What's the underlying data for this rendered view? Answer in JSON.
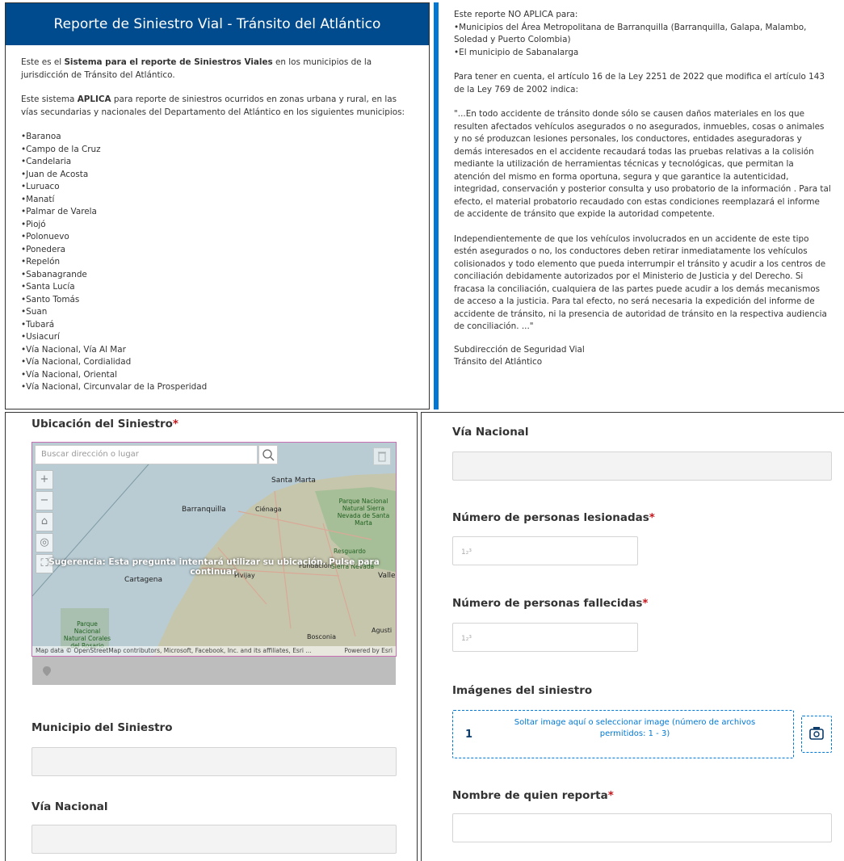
{
  "panel1": {
    "title": "Reporte de Siniestro Vial - Tránsito del Atlántico",
    "intro_before": "Este es el ",
    "intro_bold": "Sistema para el reporte de Siniestros Viales",
    "intro_after": " en los municipios de la jurisdicción de Tránsito del Atlántico.",
    "scope_before": "Este sistema ",
    "scope_bold": "APLICA",
    "scope_after": " para reporte de siniestros ocurridos en zonas urbana y rural, en las vías secundarias y nacionales del Departamento del Atlántico en los siguientes municipios:",
    "municipios": [
      "Baranoa",
      "Campo de la Cruz",
      "Candelaria",
      "Juan de Acosta",
      "Luruaco",
      "Manatí",
      "Palmar de Varela",
      "Piojó",
      "Polonuevo",
      "Ponedera",
      "Repelón",
      "Sabanagrande",
      "Santa Lucía",
      "Santo Tomás",
      "Suan",
      "Tubará",
      "Usiacurí",
      "Vía Nacional, Vía Al Mar",
      "Vía Nacional, Cordialidad",
      "Vía Nacional, Oriental",
      "Vía Nacional, Circunvalar de la Prosperidad"
    ]
  },
  "panel2": {
    "no_aplica_title": "Este reporte NO APLICA para:",
    "no_aplica_1": "•Municipios del Área Metropolitana de Barranquilla (Barranquilla, Galapa, Malambo, Soledad y Puerto Colombia)",
    "no_aplica_2": "•El municipio de Sabanalarga",
    "ley_intro": "Para tener en cuenta, el artículo 16 de la Ley 2251 de 2022 que modifica el artículo 143 de la Ley 769 de 2002 indica:",
    "quote_1": "\"...En todo accidente de tránsito donde sólo se causen daños materiales en los que resulten afectados vehículos asegurados o no asegurados, inmuebles, cosas o animales y no sé produzcan lesiones personales, los conductores, entidades aseguradoras y demás interesados en el accidente recaudará todas las pruebas relativas a la colisión mediante la utilización de herramientas técnicas y tecnológicas, que permitan la atención del mismo en forma oportuna, segura y que garantice la autenticidad, integridad, conservación y posterior consulta y uso probatorio de la información . Para tal efecto, el material probatorio recaudado con estas condiciones reemplazará el informe de accidente de tránsito que expide la autoridad competente.",
    "quote_2": "Independientemente de que los vehículos involucrados en un accidente de este tipo estén asegurados o no, los conductores deben retirar inmediatamente los vehículos colisionados y todo elemento que pueda interrumpir el tránsito y acudir a los centros de conciliación debidamente autorizados por el Ministerio de Justicia y del Derecho. Si fracasa la conciliación, cualquiera de las partes puede acudir a los demás mecanismos de acceso a la justicia. Para tal efecto, no será necesaria la expedición del informe de accidente de tránsito, ni la presencia de autoridad de tránsito en la respectiva audiencia de conciliación. ...\"",
    "sign_1": "Subdirección de Seguridad Vial",
    "sign_2": "Tránsito del Atlántico"
  },
  "panel3": {
    "ubicacion_label": "Ubicación del Siniestro",
    "required_mark": "*",
    "search_placeholder": "Buscar dirección o lugar",
    "map_hint": "Sugerencia: Esta pregunta intentará utilizar su ubicación. Pulse para continuar.",
    "map_attribution": "Map data © OpenStreetMap contributors, Microsoft, Facebook, Inc. and its affiliates, Esri ...",
    "powered_by": "Powered by Esri",
    "map_labels": {
      "santa_marta": "Santa Marta",
      "barranquilla": "Barranquilla",
      "cienaga": "Ciénaga",
      "parque_sierra": "Parque Nacional Natural Sierra Nevada de Santa Marta",
      "resguardo": "Resguardo",
      "sierra_nevada": "Sierra Nevada",
      "fundacion": "Fundación",
      "cartagena": "Cartagena",
      "pivijay": "Pivijay",
      "valle": "Valle",
      "parque_corales": "Parque Nacional Natural Corales del Rosario",
      "bosconia": "Bosconia",
      "agustin": "Agusti"
    },
    "municipio_label": "Municipio del Siniestro",
    "via_label": "Vía Nacional"
  },
  "panel4": {
    "via_label": "Vía Nacional",
    "lesionadas_label": "Número de personas lesionadas",
    "fallecidas_label": "Número de personas fallecidas",
    "required_mark": "*",
    "imagenes_label": "Imágenes del siniestro",
    "upload_count": "1",
    "upload_text": "Soltar image aquí o seleccionar image (número de archivos permitidos: 1 - 3)",
    "reporta_label": "Nombre de quien reporta"
  },
  "colors": {
    "header": "#004b8d",
    "accent": "#0078d4",
    "required": "#c4161c"
  }
}
